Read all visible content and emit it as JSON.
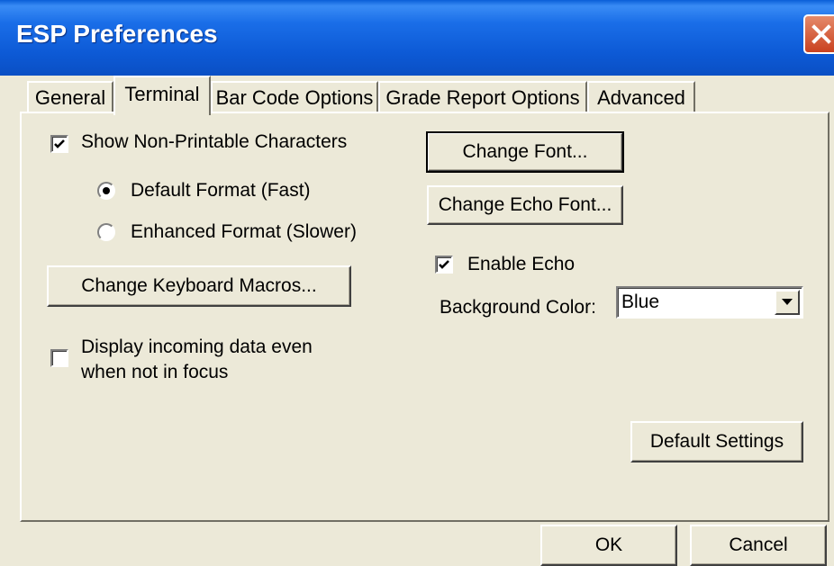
{
  "window": {
    "title": "ESP Preferences"
  },
  "tabs": [
    {
      "label": "General"
    },
    {
      "label": "Terminal"
    },
    {
      "label": "Bar Code Options"
    },
    {
      "label": "Grade Report Options"
    },
    {
      "label": "Advanced"
    }
  ],
  "active_tab": "Terminal",
  "terminal": {
    "show_nonprintable": {
      "label": "Show Non-Printable Characters",
      "checked": true
    },
    "format_options": [
      {
        "label": "Default Format (Fast)",
        "selected": true
      },
      {
        "label": "Enhanced Format (Slower)",
        "selected": false
      }
    ],
    "change_macros_label": "Change Keyboard Macros...",
    "display_incoming": {
      "line1": "Display incoming data even",
      "line2": "when not in focus",
      "checked": false
    },
    "change_font_label": "Change Font...",
    "change_echo_font_label": "Change Echo Font...",
    "enable_echo": {
      "label": "Enable Echo",
      "checked": true
    },
    "background_color": {
      "label": "Background Color:",
      "value": "Blue"
    },
    "default_settings_label": "Default Settings"
  },
  "footer": {
    "ok_label": "OK",
    "cancel_label": "Cancel"
  }
}
